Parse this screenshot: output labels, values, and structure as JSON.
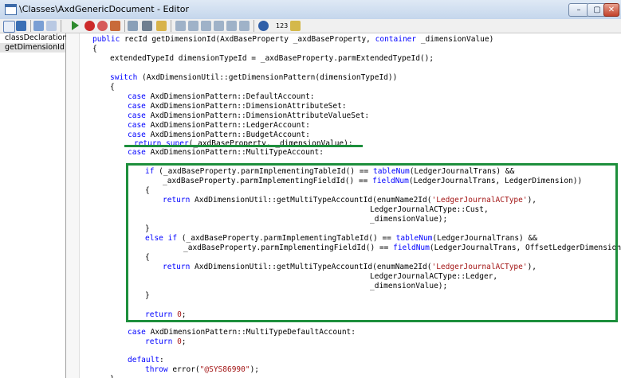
{
  "window": {
    "title": "\\Classes\\AxdGenericDocument - Editor",
    "minimize_label": "–",
    "restore_label": "▢",
    "close_label": "✕"
  },
  "toolbar": {
    "indicator_label": "123"
  },
  "methods": [
    "classDeclaration",
    "getDimensionId"
  ],
  "code_lines": [
    [
      {
        "t": "public",
        "k": "kw"
      },
      {
        "t": " recId getDimensionId(AxdBaseProperty _axdBaseProperty, "
      },
      {
        "t": "container",
        "k": "kw"
      },
      {
        "t": " _dimensionValue)"
      }
    ],
    [
      {
        "t": "{"
      }
    ],
    [
      {
        "t": "extendedTypeId dimensionTypeId = _axdBaseProperty.parmExtendedTypeId();"
      }
    ],
    [],
    [
      {
        "t": "switch",
        "k": "kw"
      },
      {
        "t": " (AxdDimensionUtil::getDimensionPattern(dimensionTypeId))"
      }
    ],
    [
      {
        "t": "{"
      }
    ],
    [
      {
        "t": "case",
        "k": "kw"
      },
      {
        "t": " AxdDimensionPattern::DefaultAccount:"
      }
    ],
    [
      {
        "t": "case",
        "k": "kw"
      },
      {
        "t": " AxdDimensionPattern::DimensionAttributeSet:"
      }
    ],
    [
      {
        "t": "case",
        "k": "kw"
      },
      {
        "t": " AxdDimensionPattern::DimensionAttributeValueSet:"
      }
    ],
    [
      {
        "t": "case",
        "k": "kw"
      },
      {
        "t": " AxdDimensionPattern::LedgerAccount:"
      }
    ],
    [
      {
        "t": "case",
        "k": "kw"
      },
      {
        "t": " AxdDimensionPattern::BudgetAccount:"
      }
    ],
    [
      {
        "t": "return",
        "k": "kw"
      },
      {
        "t": " "
      },
      {
        "t": "super",
        "k": "kw"
      },
      {
        "t": "(_axdBaseProperty, _dimensionValue);"
      }
    ],
    [
      {
        "t": "case",
        "k": "kw"
      },
      {
        "t": " AxdDimensionPattern::MultiTypeAccount:"
      }
    ],
    [],
    [
      {
        "t": "if",
        "k": "kw"
      },
      {
        "t": " (_axdBaseProperty.parmImplementingTableId() == "
      },
      {
        "t": "tableNum",
        "k": "kw"
      },
      {
        "t": "(LedgerJournalTrans) &&"
      }
    ],
    [
      {
        "t": "_axdBaseProperty.parmImplementingFieldId() == "
      },
      {
        "t": "fieldNum",
        "k": "kw"
      },
      {
        "t": "(LedgerJournalTrans, LedgerDimension))"
      }
    ],
    [
      {
        "t": "{"
      }
    ],
    [
      {
        "t": "return",
        "k": "kw"
      },
      {
        "t": " AxdDimensionUtil::getMultiTypeAccountId(enumName2Id("
      },
      {
        "t": "'LedgerJournalACType'",
        "k": "str"
      },
      {
        "t": "),"
      }
    ],
    [
      {
        "t": "LedgerJournalACType::Cust,"
      }
    ],
    [
      {
        "t": "_dimensionValue);"
      }
    ],
    [],
    [
      {
        "t": "}"
      }
    ],
    [
      {
        "t": "else",
        "k": "kw"
      },
      {
        "t": " "
      },
      {
        "t": "if",
        "k": "kw"
      },
      {
        "t": " (_axdBaseProperty.parmImplementingTableId() == "
      },
      {
        "t": "tableNum",
        "k": "kw"
      },
      {
        "t": "(LedgerJournalTrans) &&"
      }
    ],
    [
      {
        "t": "_axdBaseProperty.parmImplementingFieldId() == "
      },
      {
        "t": "fieldNum",
        "k": "kw"
      },
      {
        "t": "(LedgerJournalTrans, OffsetLedgerDimension))"
      }
    ],
    [
      {
        "t": "{"
      }
    ],
    [
      {
        "t": "return",
        "k": "kw"
      },
      {
        "t": " AxdDimensionUtil::getMultiTypeAccountId(enumName2Id("
      },
      {
        "t": "'LedgerJournalACType'",
        "k": "str"
      },
      {
        "t": "),"
      }
    ],
    [
      {
        "t": "LedgerJournalACType::Ledger,"
      }
    ],
    [
      {
        "t": "_dimensionValue);"
      }
    ],
    [],
    [
      {
        "t": "}"
      }
    ],
    [],
    [
      {
        "t": "return",
        "k": "kw"
      },
      {
        "t": " "
      },
      {
        "t": "0",
        "k": "num"
      },
      {
        "t": ";"
      }
    ],
    [],
    [
      {
        "t": "case",
        "k": "kw"
      },
      {
        "t": " AxdDimensionPattern::MultiTypeDefaultAccount:"
      }
    ],
    [
      {
        "t": "return",
        "k": "kw"
      },
      {
        "t": " "
      },
      {
        "t": "0",
        "k": "num"
      },
      {
        "t": ";"
      }
    ],
    [],
    [
      {
        "t": "default",
        "k": "kw"
      },
      {
        "t": ":"
      }
    ],
    [
      {
        "t": "throw",
        "k": "kw"
      },
      {
        "t": " error("
      },
      {
        "t": "\"@SYS86990\"",
        "k": "str"
      },
      {
        "t": ");"
      }
    ],
    [
      {
        "t": "}"
      }
    ]
  ],
  "colors": {
    "keyword": "#0000ff",
    "string": "#a31515",
    "highlight": "#1d8f3c"
  }
}
